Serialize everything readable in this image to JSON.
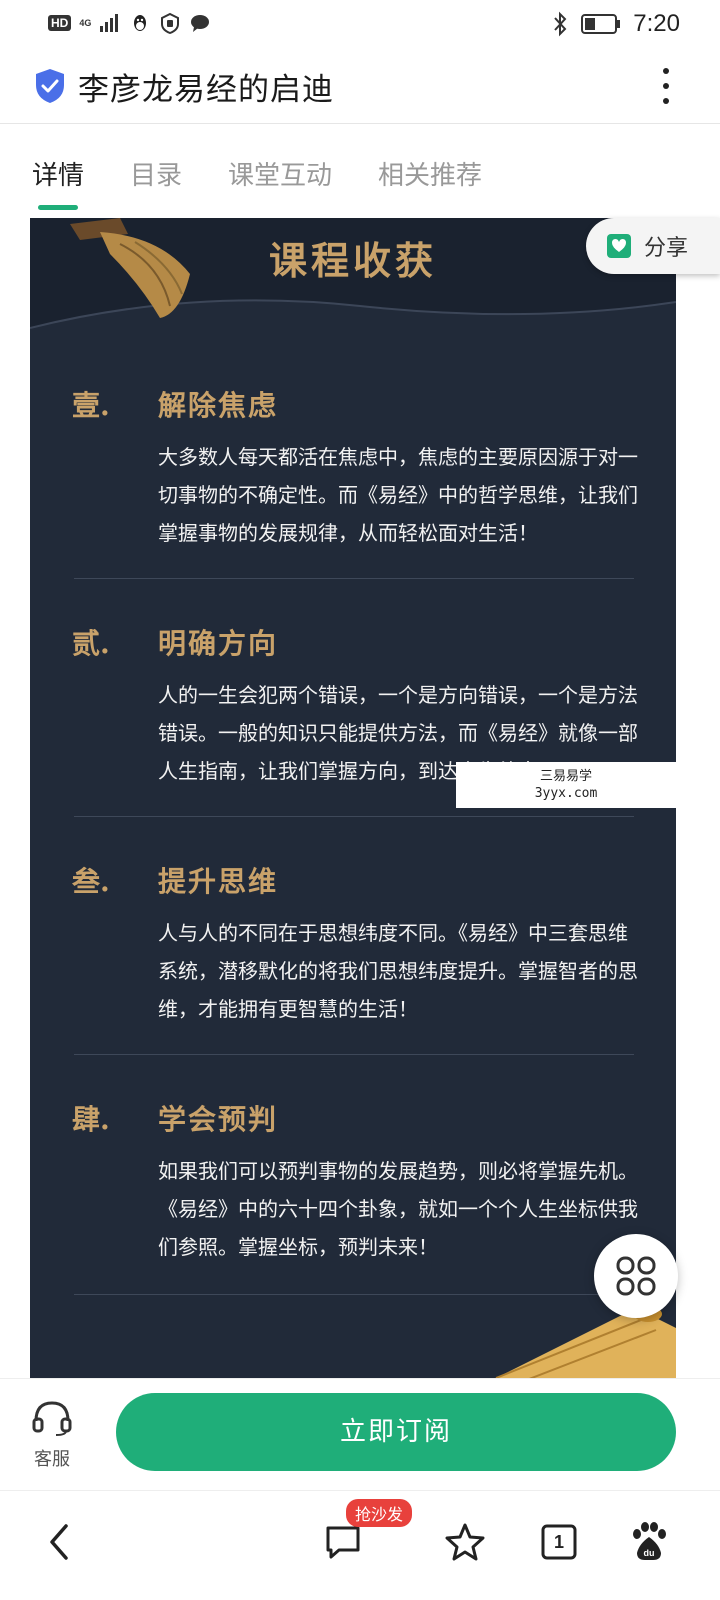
{
  "status_bar": {
    "hd": "HD",
    "network": "4G",
    "time": "7:20"
  },
  "header": {
    "title": "李彦龙易经的启迪"
  },
  "tabs": [
    {
      "label": "详情",
      "active": true
    },
    {
      "label": "目录",
      "active": false
    },
    {
      "label": "课堂互动",
      "active": false
    },
    {
      "label": "相关推荐",
      "active": false
    }
  ],
  "share": {
    "label": "分享"
  },
  "card": {
    "title": "课程收获",
    "sections": [
      {
        "num": "壹.",
        "heading": "解除焦虑",
        "body": "大多数人每天都活在焦虑中，焦虑的主要原因源于对一切事物的不确定性。而《易经》中的哲学思维，让我们掌握事物的发展规律，从而轻松面对生活！"
      },
      {
        "num": "贰.",
        "heading": "明确方向",
        "body": "人的一生会犯两个错误，一个是方向错误，一个是方法错误。一般的知识只能提供方法，而《易经》就像一部人生指南，让我们掌握方向，到达人生彼岸！"
      },
      {
        "num": "叁.",
        "heading": "提升思维",
        "body": "人与人的不同在于思想纬度不同。《易经》中三套思维系统，潜移默化的将我们思想纬度提升。掌握智者的思维，才能拥有更智慧的生活！"
      },
      {
        "num": "肆.",
        "heading": "学会预判",
        "body": "如果我们可以预判事物的发展趋势，则必将掌握先机。《易经》中的六十四个卦象，就如一个个人生坐标供我们参照。掌握坐标，预判未来！"
      }
    ]
  },
  "watermark": {
    "line1": "三易易学",
    "line2": "3yyx.com"
  },
  "subscribe_bar": {
    "customer_service_label": "客服",
    "subscribe_label": "立即订阅"
  },
  "bottom_nav": {
    "comment_badge": "抢沙发",
    "tab_count": "1"
  },
  "colors": {
    "accent": "#1fae79",
    "card_bg": "#212a39",
    "gold": "#c9a26a",
    "badge": "#e8413c"
  }
}
